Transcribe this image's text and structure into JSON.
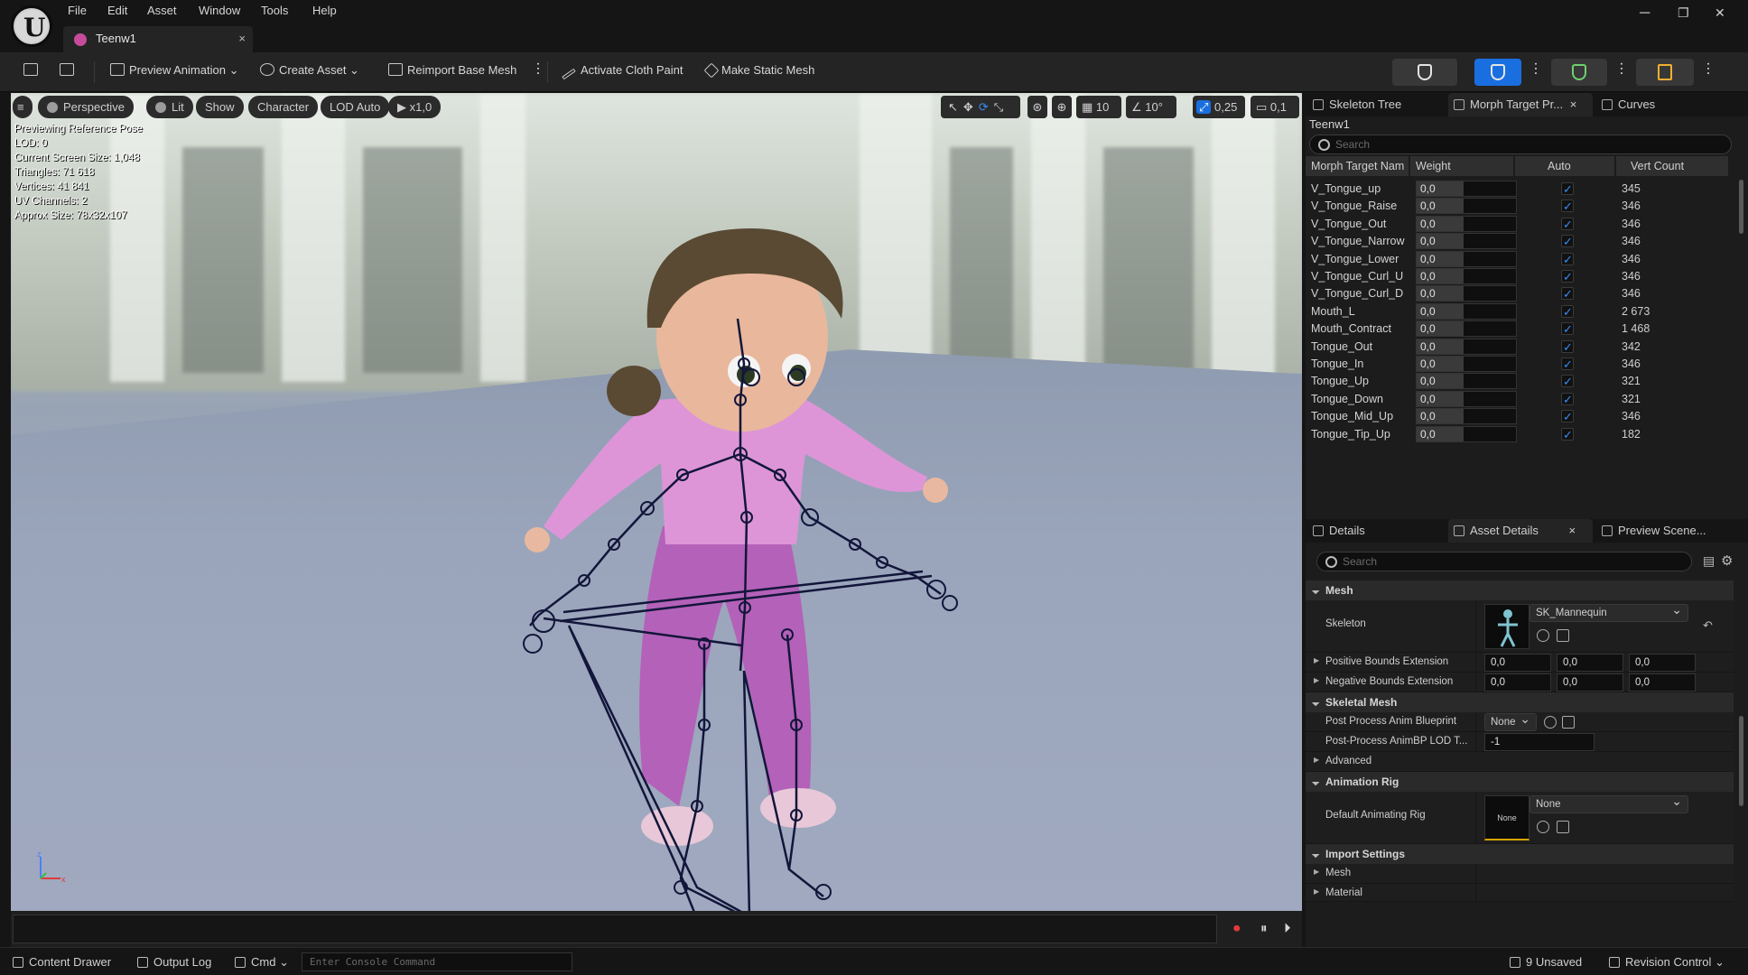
{
  "menu": [
    "File",
    "Edit",
    "Asset",
    "Window",
    "Tools",
    "Help"
  ],
  "doc_tab": {
    "label": "Teenw1",
    "close": "×"
  },
  "window_controls": {
    "minimize": "─",
    "restore": "❐",
    "close": "✕"
  },
  "toolbar": {
    "preview_animation": "Preview Animation",
    "create_asset": "Create Asset",
    "reimport": "Reimport Base Mesh",
    "cloth_paint": "Activate Cloth Paint",
    "static_mesh": "Make Static Mesh"
  },
  "viewport": {
    "buttons": {
      "perspective": "Perspective",
      "lit": "Lit",
      "show": "Show",
      "character": "Character",
      "lod": "LOD Auto",
      "speed": "x1,0"
    },
    "right_controls": {
      "grid": "10",
      "angle": "10°",
      "scale": "0,25",
      "camera": "0,1"
    },
    "stats": [
      "Previewing Reference Pose",
      "LOD: 0",
      "Current Screen Size: 1,048",
      "Triangles: 71 618",
      "Vertices: 41 841",
      "UV Channels: 2",
      "Approx Size: 78x32x107"
    ]
  },
  "morph_panel": {
    "tabs": {
      "skeleton_tree": "Skeleton Tree",
      "morph": "Morph Target Pr...",
      "curves": "Curves",
      "close": "×"
    },
    "asset_name": "Teenw1",
    "search_placeholder": "Search",
    "columns": {
      "name": "Morph Target Nam",
      "weight": "Weight",
      "auto": "Auto",
      "vert_count": "Vert Count"
    },
    "rows": [
      {
        "name": "V_Tongue_up",
        "weight": "0,0",
        "vert": "345"
      },
      {
        "name": "V_Tongue_Raise",
        "weight": "0,0",
        "vert": "346"
      },
      {
        "name": "V_Tongue_Out",
        "weight": "0,0",
        "vert": "346"
      },
      {
        "name": "V_Tongue_Narrow",
        "weight": "0,0",
        "vert": "346"
      },
      {
        "name": "V_Tongue_Lower",
        "weight": "0,0",
        "vert": "346"
      },
      {
        "name": "V_Tongue_Curl_U",
        "weight": "0,0",
        "vert": "346"
      },
      {
        "name": "V_Tongue_Curl_D",
        "weight": "0,0",
        "vert": "346"
      },
      {
        "name": "Mouth_L",
        "weight": "0,0",
        "vert": "2 673"
      },
      {
        "name": "Mouth_Contract",
        "weight": "0,0",
        "vert": "1 468"
      },
      {
        "name": "Tongue_Out",
        "weight": "0,0",
        "vert": "342"
      },
      {
        "name": "Tongue_In",
        "weight": "0,0",
        "vert": "346"
      },
      {
        "name": "Tongue_Up",
        "weight": "0,0",
        "vert": "321"
      },
      {
        "name": "Tongue_Down",
        "weight": "0,0",
        "vert": "321"
      },
      {
        "name": "Tongue_Mid_Up",
        "weight": "0,0",
        "vert": "346"
      },
      {
        "name": "Tongue_Tip_Up",
        "weight": "0,0",
        "vert": "182"
      }
    ]
  },
  "details_panel": {
    "tabs": {
      "details": "Details",
      "asset_details": "Asset Details",
      "preview_scene": "Preview Scene...",
      "close": "×"
    },
    "search_placeholder": "Search",
    "sections": {
      "mesh": "Mesh",
      "skeletal_mesh": "Skeletal Mesh",
      "animation_rig": "Animation Rig",
      "import_settings": "Import Settings"
    },
    "skeleton": {
      "label": "Skeleton",
      "value": "SK_Mannequin"
    },
    "positive_bounds": {
      "label": "Positive Bounds Extension",
      "x": "0,0",
      "y": "0,0",
      "z": "0,0"
    },
    "negative_bounds": {
      "label": "Negative Bounds Extension",
      "x": "0,0",
      "y": "0,0",
      "z": "0,0"
    },
    "post_process": {
      "label": "Post Process Anim Blueprint",
      "value": "None"
    },
    "post_process_lod": {
      "label": "Post-Process AnimBP LOD T...",
      "value": "-1"
    },
    "advanced": "Advanced",
    "default_rig": {
      "label": "Default Animating Rig",
      "thumb": "None",
      "value": "None"
    },
    "import_mesh": "Mesh",
    "import_material": "Material"
  },
  "statusbar": {
    "content_drawer": "Content Drawer",
    "output_log": "Output Log",
    "cmd": "Cmd",
    "console_placeholder": "Enter Console Command",
    "unsaved": "9 Unsaved",
    "revision": "Revision Control"
  },
  "colors": {
    "accent": "#1a6fe0",
    "checkbox": "#3b8cf5",
    "skeleton_lines": "#12163a",
    "shirt": "#d98fd6",
    "pants": "#b05cb8"
  }
}
